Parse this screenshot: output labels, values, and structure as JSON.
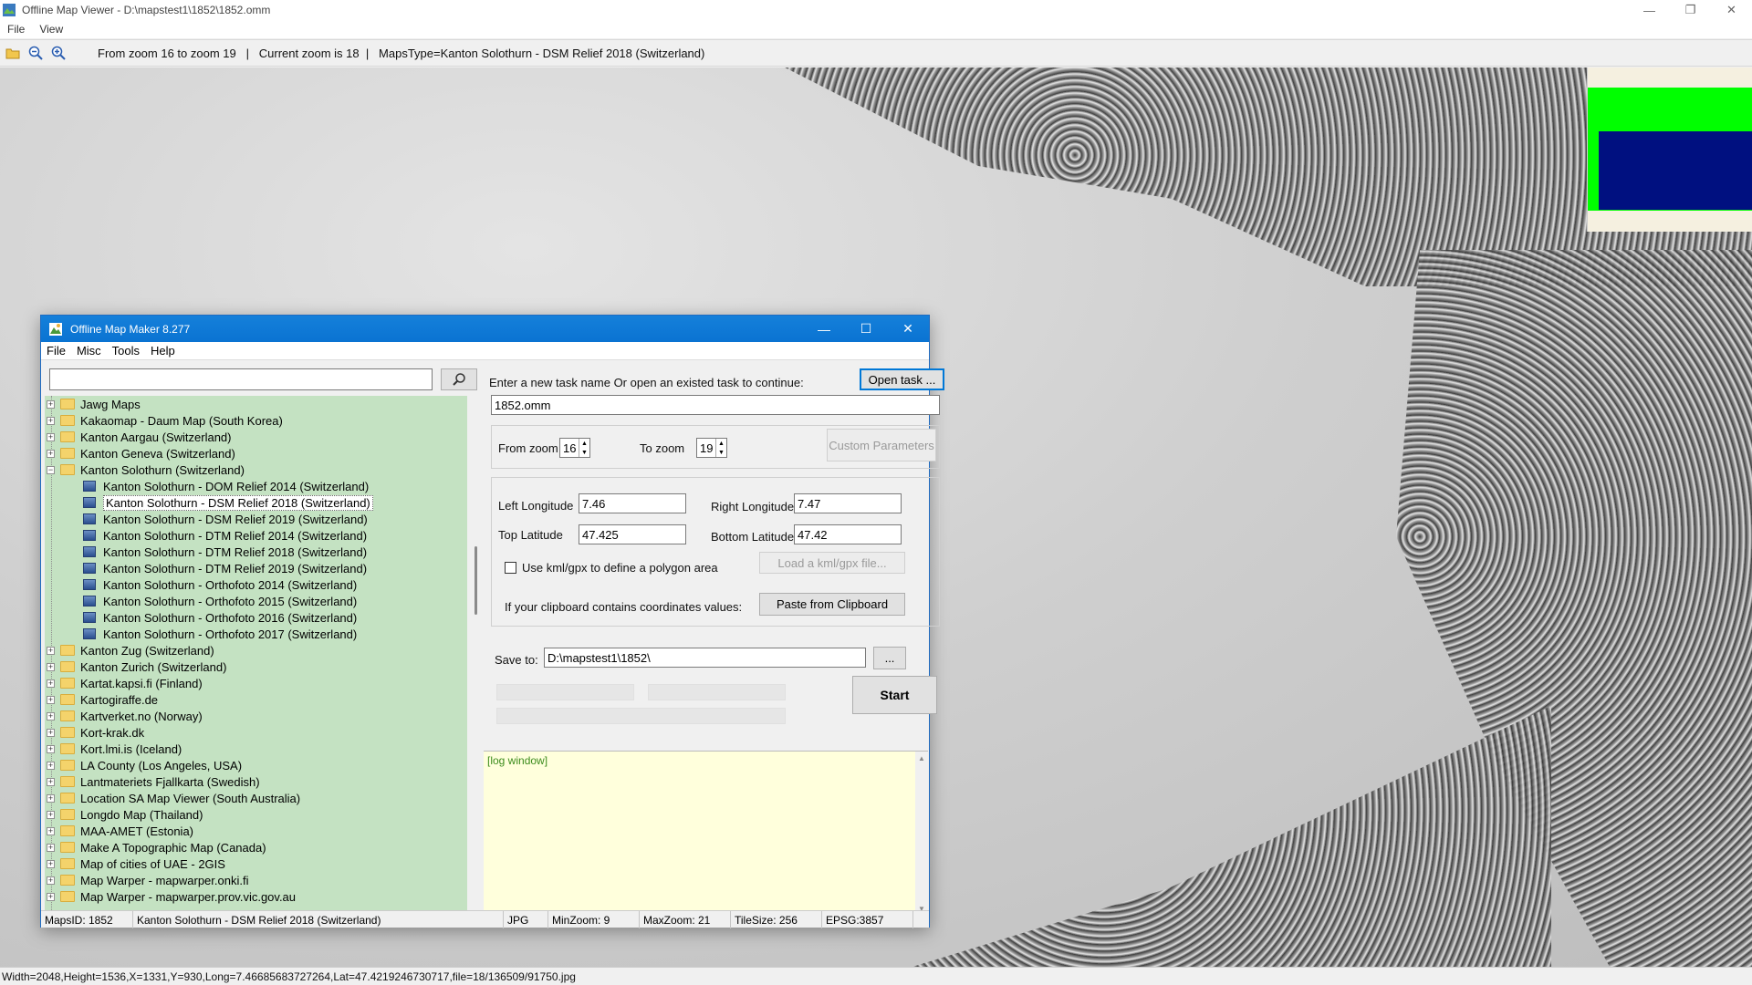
{
  "viewer": {
    "title": "Offline Map Viewer - D:\\mapstest1\\1852\\1852.omm",
    "menu": [
      "File",
      "View"
    ],
    "toolbar": {
      "status": "From zoom 16 to zoom 19   |   Current zoom is 18  |   MapsType=Kanton Solothurn - DSM Relief 2018 (Switzerland)"
    },
    "statusbar": "Width=2048,Height=1536,X=1331,Y=930,Long=7.46685683727264,Lat=47.4219246730717,file=18/136509/91750.jpg",
    "window_controls": [
      "—",
      "❐",
      "✕"
    ]
  },
  "maker": {
    "title": "Offline Map Maker 8.277",
    "menu": [
      "File",
      "Misc",
      "Tools",
      "Help"
    ],
    "search": {
      "value": ""
    },
    "tree": [
      {
        "label": "Jawg Maps",
        "type": "folder",
        "expanded": false
      },
      {
        "label": "Kakaomap - Daum Map (South Korea)",
        "type": "folder",
        "expanded": false
      },
      {
        "label": "Kanton Aargau (Switzerland)",
        "type": "folder",
        "expanded": false
      },
      {
        "label": "Kanton Geneva (Switzerland)",
        "type": "folder",
        "expanded": false
      },
      {
        "label": "Kanton Solothurn (Switzerland)",
        "type": "folder",
        "expanded": true
      },
      {
        "label": "Kanton Solothurn - DOM Relief 2014 (Switzerland)",
        "type": "map"
      },
      {
        "label": "Kanton Solothurn - DSM Relief 2018 (Switzerland)",
        "type": "map",
        "selected": true
      },
      {
        "label": "Kanton Solothurn - DSM Relief 2019 (Switzerland)",
        "type": "map"
      },
      {
        "label": "Kanton Solothurn - DTM Relief 2014 (Switzerland)",
        "type": "map"
      },
      {
        "label": "Kanton Solothurn - DTM Relief 2018 (Switzerland)",
        "type": "map"
      },
      {
        "label": "Kanton Solothurn - DTM Relief 2019 (Switzerland)",
        "type": "map"
      },
      {
        "label": "Kanton Solothurn - Orthofoto 2014 (Switzerland)",
        "type": "map"
      },
      {
        "label": "Kanton Solothurn - Orthofoto 2015 (Switzerland)",
        "type": "map"
      },
      {
        "label": "Kanton Solothurn - Orthofoto 2016 (Switzerland)",
        "type": "map"
      },
      {
        "label": "Kanton Solothurn - Orthofoto 2017 (Switzerland)",
        "type": "map"
      },
      {
        "label": "Kanton Zug (Switzerland)",
        "type": "folder",
        "expanded": false
      },
      {
        "label": "Kanton Zurich (Switzerland)",
        "type": "folder",
        "expanded": false
      },
      {
        "label": "Kartat.kapsi.fi (Finland)",
        "type": "folder",
        "expanded": false
      },
      {
        "label": "Kartogiraffe.de",
        "type": "folder",
        "expanded": false
      },
      {
        "label": "Kartverket.no (Norway)",
        "type": "folder",
        "expanded": false
      },
      {
        "label": "Kort-krak.dk",
        "type": "folder",
        "expanded": false
      },
      {
        "label": "Kort.lmi.is (Iceland)",
        "type": "folder",
        "expanded": false
      },
      {
        "label": "LA County (Los Angeles, USA)",
        "type": "folder",
        "expanded": false
      },
      {
        "label": "Lantmateriets Fjallkarta (Swedish)",
        "type": "folder",
        "expanded": false
      },
      {
        "label": "Location SA Map Viewer (South Australia)",
        "type": "folder",
        "expanded": false
      },
      {
        "label": "Longdo Map (Thailand)",
        "type": "folder",
        "expanded": false
      },
      {
        "label": "MAA-AMET (Estonia)",
        "type": "folder",
        "expanded": false
      },
      {
        "label": "Make A Topographic Map (Canada)",
        "type": "folder",
        "expanded": false
      },
      {
        "label": "Map of cities of UAE - 2GIS",
        "type": "folder",
        "expanded": false
      },
      {
        "label": "Map Warper - mapwarper.onki.fi",
        "type": "folder",
        "expanded": false
      },
      {
        "label": "Map Warper - mapwarper.prov.vic.gov.au",
        "type": "folder",
        "expanded": false
      }
    ],
    "form": {
      "task_prompt": "Enter a new task name Or open an existed task to continue:",
      "open_task_label": "Open task ...",
      "task_name": "1852.omm",
      "from_zoom_label": "From zoom",
      "from_zoom": "16",
      "to_zoom_label": "To zoom",
      "to_zoom": "19",
      "custom_params_label": "Custom Parameters",
      "left_lon_label": "Left Longitude",
      "left_lon": "7.46",
      "right_lon_label": "Right Longitude",
      "right_lon": "7.47",
      "top_lat_label": "Top Latitude",
      "top_lat": "47.425",
      "bottom_lat_label": "Bottom Latitude",
      "bottom_lat": "47.42",
      "kml_checkbox_label": "Use kml/gpx to define a polygon area",
      "kml_checked": false,
      "load_kml_label": "Load a kml/gpx file...",
      "clipboard_prompt": "If your clipboard contains coordinates values:",
      "paste_label": "Paste from Clipboard",
      "save_to_label": "Save to:",
      "save_to": "D:\\mapstest1\\1852\\",
      "browse_label": "...",
      "start_label": "Start",
      "log_text": "[log window]"
    },
    "status": {
      "maps_id": "MapsID: 1852",
      "map_name": "Kanton Solothurn - DSM Relief 2018 (Switzerland)",
      "format": "JPG",
      "min_zoom": "MinZoom: 9",
      "max_zoom": "MaxZoom: 21",
      "tile_size": "TileSize: 256",
      "epsg": "EPSG:3857"
    },
    "window_controls": [
      "—",
      "☐",
      "✕"
    ]
  },
  "colors": {
    "tree_bg": "#c4e2c2",
    "titlebar": "#0078d7",
    "log_bg": "#ffffdc",
    "minimap_green": "#00ff00",
    "minimap_navy": "#001080"
  }
}
